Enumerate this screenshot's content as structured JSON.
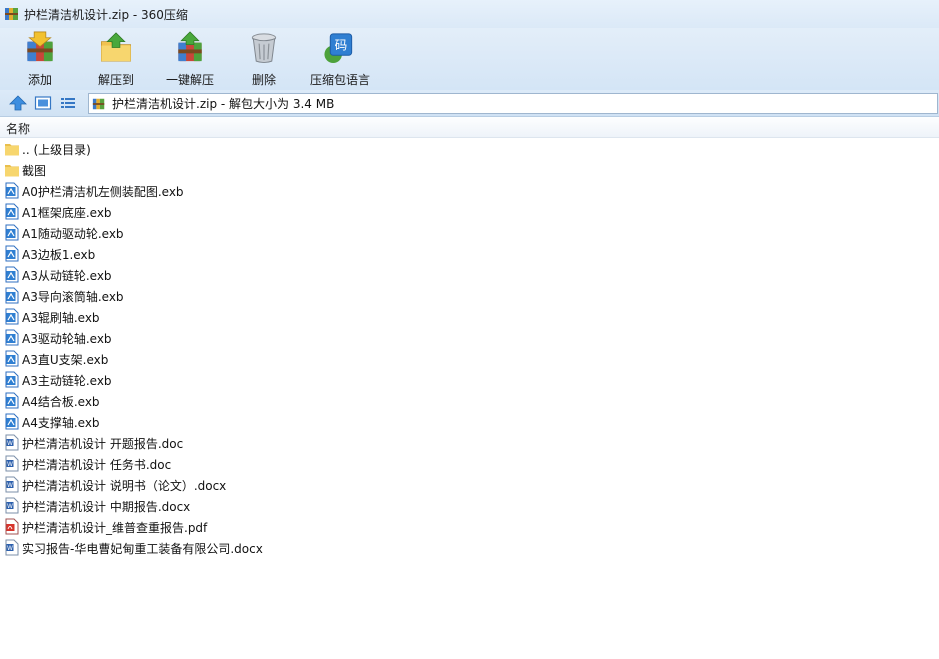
{
  "window": {
    "title": "护栏清洁机设计.zip - 360压缩"
  },
  "toolbar": {
    "add_label": "添加",
    "extract_label": "解压到",
    "onekey_label": "一键解压",
    "delete_label": "删除",
    "lang_label": "压缩包语言",
    "lang_icon_text": "码"
  },
  "address": {
    "text": "护栏清洁机设计.zip - 解包大小为 3.4 MB"
  },
  "list": {
    "column_name": "名称",
    "items": [
      {
        "name": ".. (上级目录)",
        "type": "folder"
      },
      {
        "name": "截图",
        "type": "folder"
      },
      {
        "name": "A0护栏清洁机左侧装配图.exb",
        "type": "exb"
      },
      {
        "name": "A1框架底座.exb",
        "type": "exb"
      },
      {
        "name": "A1随动驱动轮.exb",
        "type": "exb"
      },
      {
        "name": "A3边板1.exb",
        "type": "exb"
      },
      {
        "name": "A3从动链轮.exb",
        "type": "exb"
      },
      {
        "name": "A3导向滚筒轴.exb",
        "type": "exb"
      },
      {
        "name": "A3辊刷轴.exb",
        "type": "exb"
      },
      {
        "name": "A3驱动轮轴.exb",
        "type": "exb"
      },
      {
        "name": "A3直U支架.exb",
        "type": "exb"
      },
      {
        "name": "A3主动链轮.exb",
        "type": "exb"
      },
      {
        "name": "A4结合板.exb",
        "type": "exb"
      },
      {
        "name": "A4支撑轴.exb",
        "type": "exb"
      },
      {
        "name": "护栏清洁机设计 开题报告.doc",
        "type": "doc"
      },
      {
        "name": "护栏清洁机设计 任务书.doc",
        "type": "doc"
      },
      {
        "name": "护栏清洁机设计 说明书（论文）.docx",
        "type": "docx"
      },
      {
        "name": "护栏清洁机设计 中期报告.docx",
        "type": "docx"
      },
      {
        "name": "护栏清洁机设计_维普查重报告.pdf",
        "type": "pdf"
      },
      {
        "name": "实习报告-华电曹妃甸重工装备有限公司.docx",
        "type": "docx"
      }
    ]
  },
  "icons": {
    "app": "archive-icon",
    "add": "archive-add-icon",
    "extract": "folder-extract-icon",
    "onekey": "archive-onekey-icon",
    "delete": "trash-icon",
    "lang": "code-page-icon",
    "up": "up-arrow-icon",
    "view_thumb": "thumbnail-view-icon",
    "view_list": "list-view-icon"
  },
  "colors": {
    "toolbar_bg": "#d9e8f7",
    "accent_blue": "#2f7fd2",
    "folder_yellow": "#f7d66e",
    "pdf_red": "#d8332b"
  }
}
